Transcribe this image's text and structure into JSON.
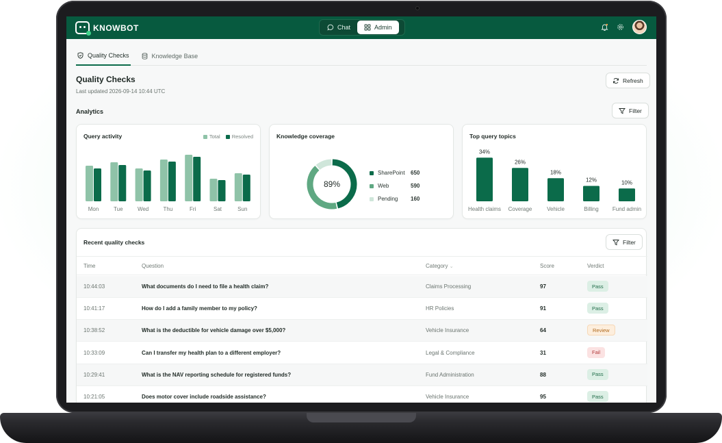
{
  "app": {
    "name": "KNOWBOT"
  },
  "nav": [
    {
      "label": "Chat",
      "active": false
    },
    {
      "label": "Admin",
      "active": true
    }
  ],
  "tabs": [
    {
      "label": "Quality Checks",
      "active": true
    },
    {
      "label": "Knowledge Base",
      "active": false
    }
  ],
  "page": {
    "title": "Quality Checks",
    "subtitle": "Last updated 2026-09-14 10:44 UTC",
    "refresh_label": "Refresh",
    "analytics_label": "Analytics",
    "filter_label": "Filter"
  },
  "colors": {
    "brand": "#075a3f",
    "dark_bar": "#0b6b4a",
    "light_bar": "#8fc3a8",
    "pending": "#cfe6da"
  },
  "query_activity": {
    "title": "Query activity",
    "legend": [
      "Total",
      "Resolved"
    ]
  },
  "knowledge_coverage": {
    "title": "Knowledge coverage",
    "center_label": "89%",
    "items": [
      {
        "name": "SharePoint",
        "value": "650"
      },
      {
        "name": "Web",
        "value": "590"
      },
      {
        "name": "Pending",
        "value": "160"
      }
    ]
  },
  "top_topics": {
    "title": "Top query topics"
  },
  "chart_data": [
    {
      "type": "bar",
      "title": "Query activity",
      "categories": [
        "Mon",
        "Tue",
        "Wed",
        "Thu",
        "Fri",
        "Sat",
        "Sun"
      ],
      "series": [
        {
          "name": "Total",
          "values": [
            52,
            57,
            48,
            61,
            68,
            33,
            41
          ]
        },
        {
          "name": "Resolved",
          "values": [
            48,
            53,
            45,
            58,
            65,
            31,
            39
          ]
        }
      ],
      "ylim": [
        0,
        75
      ]
    },
    {
      "type": "pie",
      "title": "Knowledge coverage",
      "labels": [
        "SharePoint",
        "Web",
        "Pending"
      ],
      "values": [
        650,
        590,
        160
      ]
    },
    {
      "type": "bar",
      "title": "Top query topics",
      "categories": [
        "Health claims",
        "Coverage",
        "Vehicle",
        "Billing",
        "Fund admin"
      ],
      "values": [
        34,
        26,
        18,
        12,
        10
      ],
      "value_labels": [
        "34%",
        "26%",
        "18%",
        "12%",
        "10%"
      ],
      "ylim": [
        0,
        40
      ]
    }
  ],
  "table": {
    "title": "Recent quality checks",
    "filter_label": "Filter",
    "columns": [
      "Time",
      "Question",
      "Category",
      "Score",
      "Verdict"
    ],
    "rows": [
      {
        "time": "10:44:03",
        "question": "What documents do I need to file a health claim?",
        "category": "Claims Processing",
        "score": "97",
        "verdict": "Pass"
      },
      {
        "time": "10:41:17",
        "question": "How do I add a family member to my policy?",
        "category": "HR Policies",
        "score": "91",
        "verdict": "Pass"
      },
      {
        "time": "10:38:52",
        "question": "What is the deductible for vehicle damage over $5,000?",
        "category": "Vehicle Insurance",
        "score": "64",
        "verdict": "Review"
      },
      {
        "time": "10:33:09",
        "question": "Can I transfer my health plan to a different employer?",
        "category": "Legal & Compliance",
        "score": "31",
        "verdict": "Fail"
      },
      {
        "time": "10:29:41",
        "question": "What is the NAV reporting schedule for registered funds?",
        "category": "Fund Administration",
        "score": "88",
        "verdict": "Pass"
      },
      {
        "time": "10:21:05",
        "question": "Does motor cover include roadside assistance?",
        "category": "Vehicle Insurance",
        "score": "95",
        "verdict": "Pass"
      }
    ]
  }
}
